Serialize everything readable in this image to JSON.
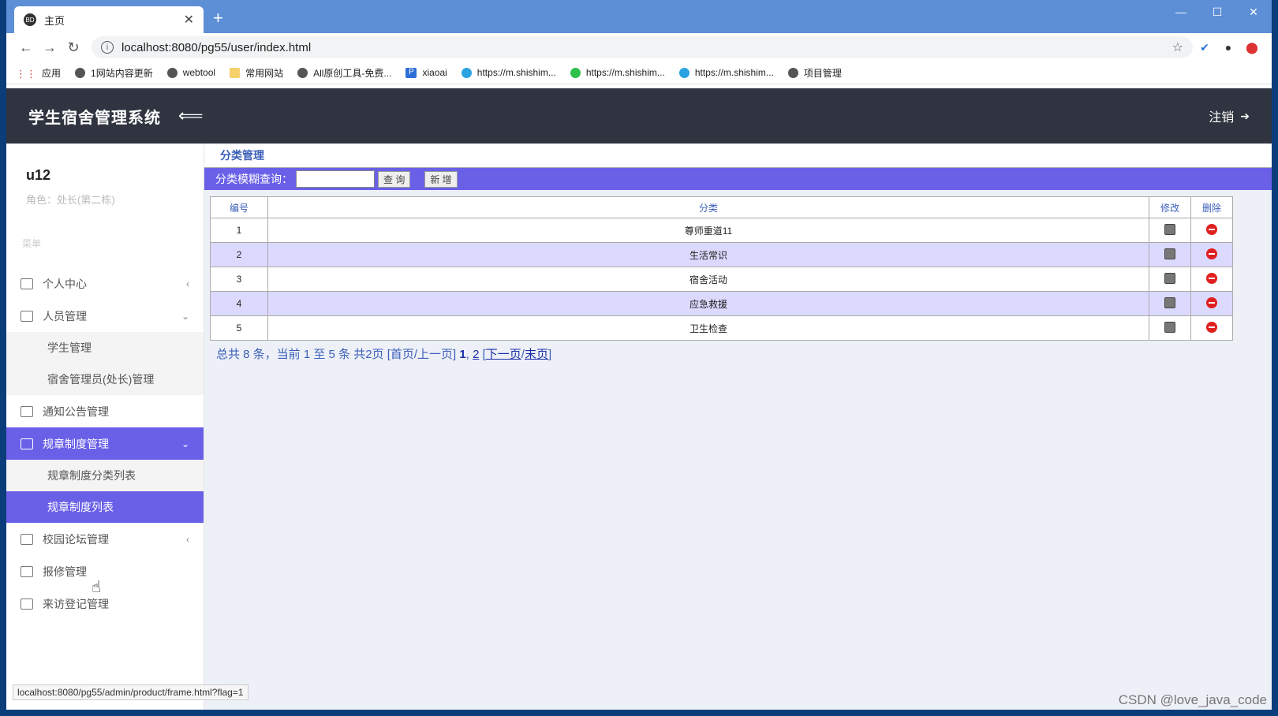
{
  "browser": {
    "tab_title": "主页",
    "tab_favicon": "BD",
    "url": "localhost:8080/pg55/user/index.html",
    "bookmarks": [
      "应用",
      "1网站内容更新",
      "webtool",
      "常用网站",
      "All原创工具-免费...",
      "xiaoai",
      "https://m.shishim...",
      "https://m.shishim...",
      "https://m.shishim...",
      "项目管理"
    ],
    "status_url": "localhost:8080/pg55/admin/product/frame.html?flag=1"
  },
  "header": {
    "title": "学生宿舍管理系统",
    "logout": "注销"
  },
  "sidebar": {
    "user_name": "u12",
    "user_role": "角色：处长(第二栋)",
    "menu_label": "菜单",
    "items": [
      {
        "label": "个人中心"
      },
      {
        "label": "人员管理"
      },
      {
        "label": "学生管理"
      },
      {
        "label": "宿舍管理员(处长)管理"
      },
      {
        "label": "通知公告管理"
      },
      {
        "label": "规章制度管理"
      },
      {
        "label": "规章制度分类列表"
      },
      {
        "label": "规章制度列表"
      },
      {
        "label": "校园论坛管理"
      },
      {
        "label": "报修管理"
      },
      {
        "label": "来访登记管理"
      }
    ]
  },
  "main": {
    "panel_title": "分类管理",
    "query_label": "分类模糊查询：",
    "query_value": "",
    "search_button": "查 询",
    "add_button": "新 增",
    "columns": [
      "编号",
      "分类",
      "修改",
      "删除"
    ],
    "rows": [
      {
        "id": "1",
        "category": "尊师重道11"
      },
      {
        "id": "2",
        "category": "生活常识"
      },
      {
        "id": "3",
        "category": "宿舍活动"
      },
      {
        "id": "4",
        "category": "应急救援"
      },
      {
        "id": "5",
        "category": "卫生检查"
      }
    ],
    "pager": {
      "summary": "总共 8 条，当前 1 至 5 条 共2页",
      "first_prev": "[首页/上一页]",
      "page1": "1",
      "page2": "2",
      "next": "下一页",
      "last": "末页"
    }
  },
  "watermark": "CSDN @love_java_code",
  "colors": {
    "accent": "#6a60e8",
    "header_bg": "#2f3440",
    "alt_row": "#dcd9ff",
    "delete": "#e02020"
  }
}
